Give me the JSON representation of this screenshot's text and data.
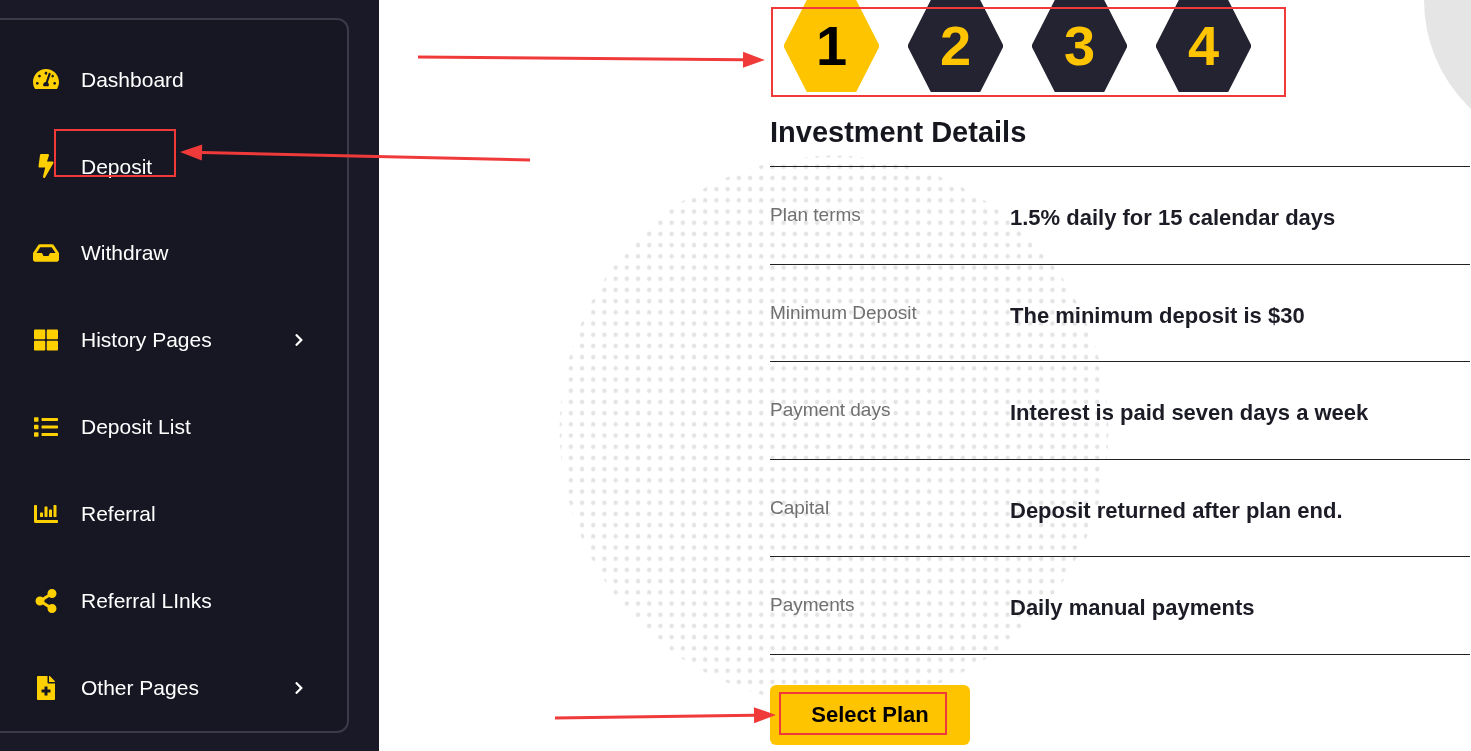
{
  "sidebar": {
    "items": [
      {
        "label": "Dashboard",
        "expandable": false
      },
      {
        "label": "Deposit",
        "expandable": false
      },
      {
        "label": "Withdraw",
        "expandable": false
      },
      {
        "label": "History Pages",
        "expandable": true
      },
      {
        "label": "Deposit List",
        "expandable": false
      },
      {
        "label": "Referral",
        "expandable": false
      },
      {
        "label": "Referral LInks",
        "expandable": false
      },
      {
        "label": "Other Pages",
        "expandable": true
      }
    ]
  },
  "steps": [
    {
      "label": "1",
      "selected": true
    },
    {
      "label": "2",
      "selected": false
    },
    {
      "label": "3",
      "selected": false
    },
    {
      "label": "4",
      "selected": false
    }
  ],
  "investment_details": {
    "title": "Investment Details",
    "rows": [
      {
        "label": "Plan terms",
        "value": "1.5% daily for 15 calendar days"
      },
      {
        "label": "Minimum Deposit",
        "value": "The minimum deposit is $30"
      },
      {
        "label": "Payment days",
        "value": "Interest is paid seven days a week"
      },
      {
        "label": "Capital",
        "value": "Deposit returned after plan end."
      },
      {
        "label": "Payments",
        "value": "Daily manual payments"
      }
    ]
  },
  "select_button": "Select Plan"
}
